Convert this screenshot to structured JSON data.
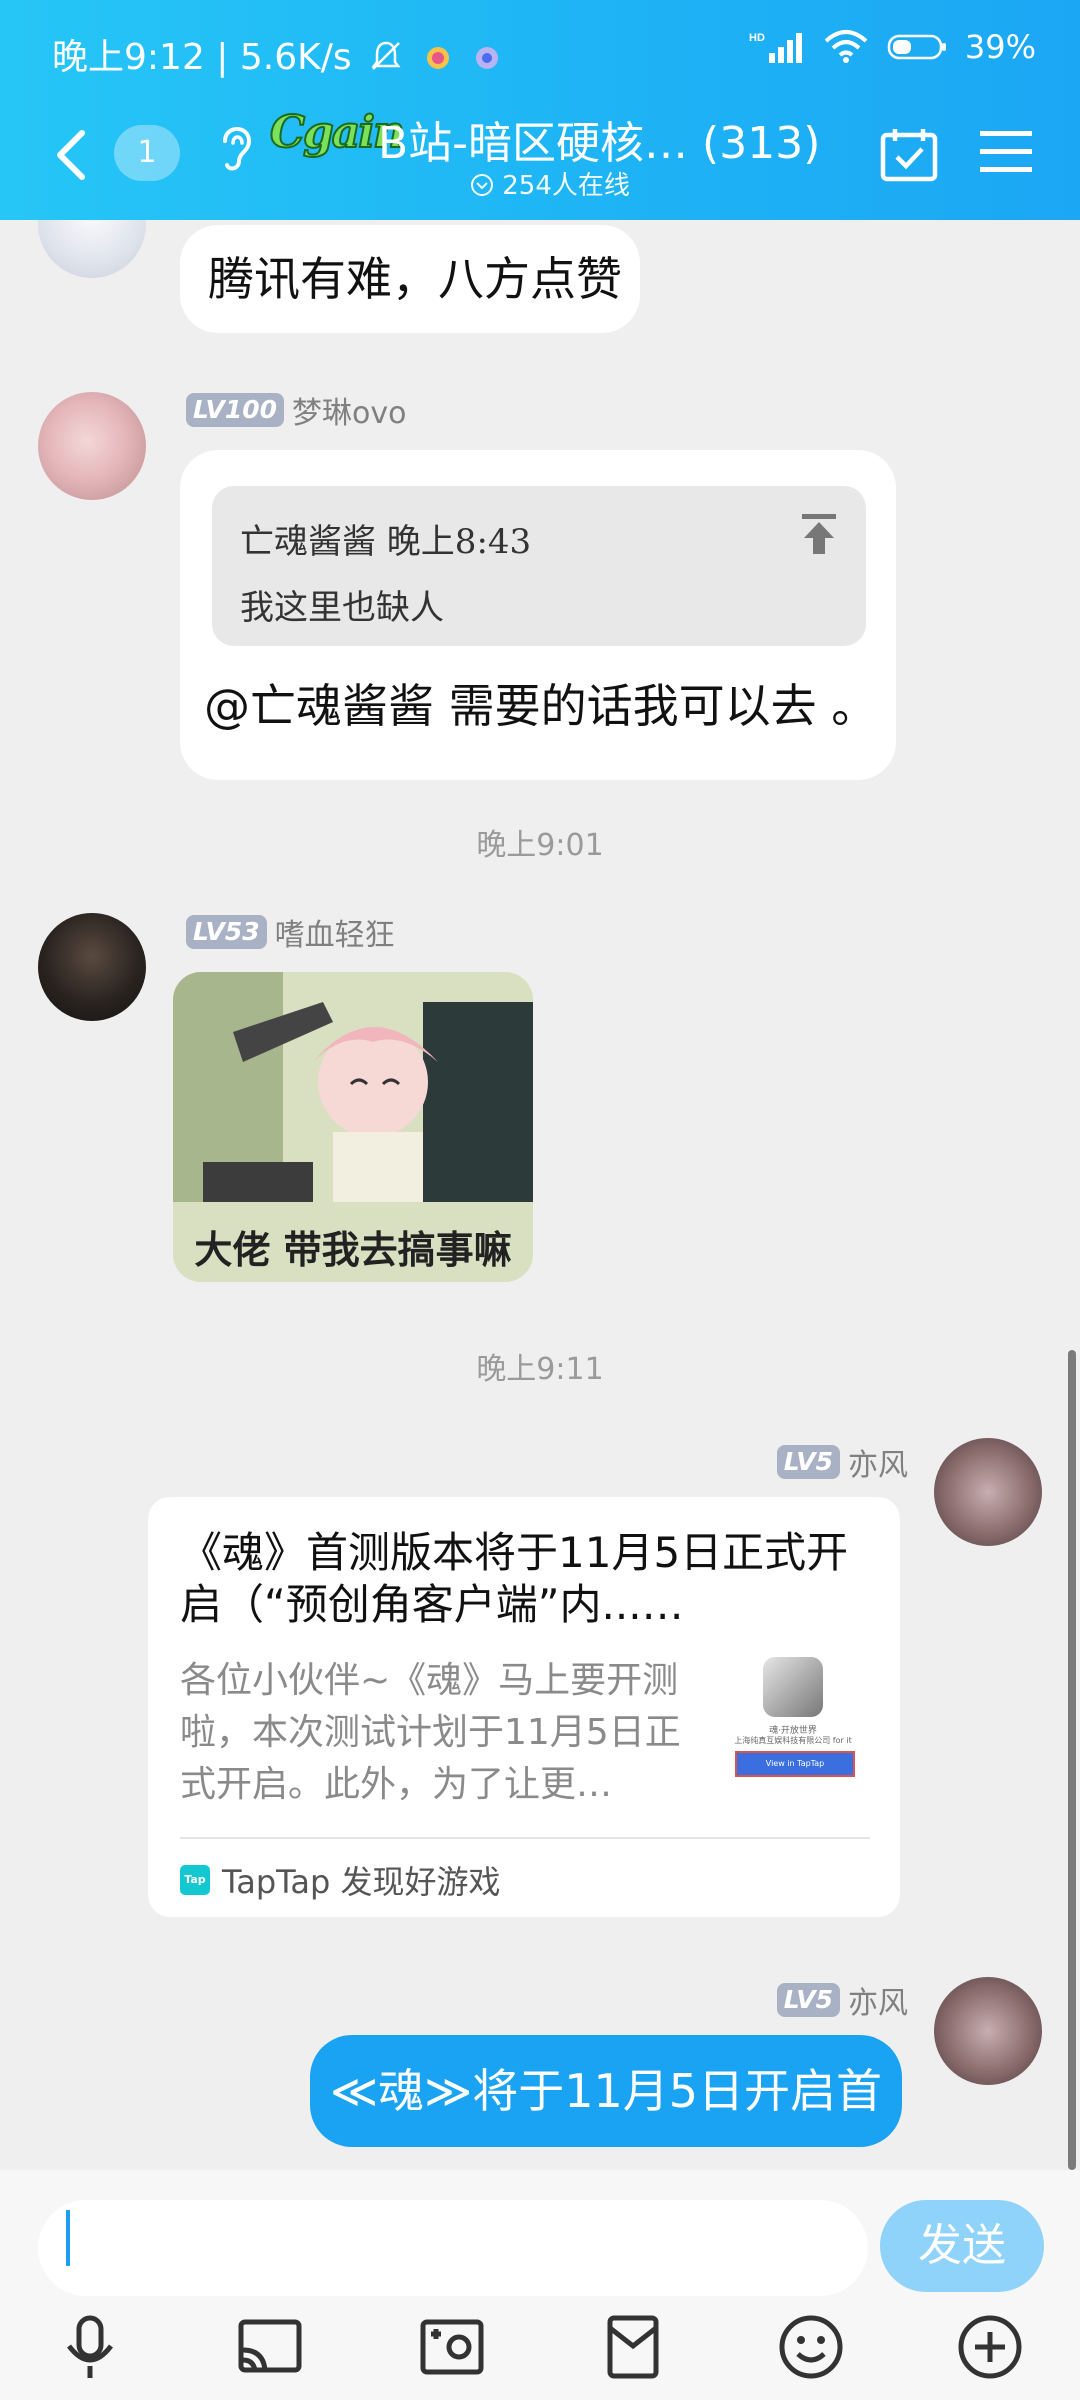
{
  "status_bar": {
    "time": "晚上9:12",
    "speed": "5.6K/s",
    "battery": "39%"
  },
  "header": {
    "unread_count": "1",
    "logo_text": "Cgain",
    "title": "B站-暗区硬核… (313)",
    "online": "254人在线"
  },
  "messages": {
    "m1": {
      "text": "腾讯有难，八方点赞"
    },
    "m2": {
      "level": "LV100",
      "name": "梦琳ovo",
      "quote_author_time": "亡魂酱酱  晚上8:43",
      "quote_text": "我这里也缺人",
      "text": "@亡魂酱酱  需要的话我可以去 。"
    },
    "t1": "晚上9:01",
    "m3": {
      "level": "LV53",
      "name": "嗜血轻狂",
      "sticker_caption": "大佬  带我去搞事嘛"
    },
    "t2": "晚上9:11",
    "m4": {
      "level": "LV5",
      "name": "亦风",
      "card_title": "《魂》首测版本将于11月5日正式开启（“预创角客户端”内...…",
      "card_desc": "各位小伙伴~《魂》马上要开测啦，本次测试计划于11月5日正式开启。此外，为了让更…",
      "thumb_line1": "魂·开放世界",
      "thumb_line2": "上海纯真互娱科技有限公司 for it",
      "thumb_button": "View in TapTap",
      "source_badge": "Tap",
      "source_name": "TapTap 发现好游戏"
    },
    "m5": {
      "level": "LV5",
      "name": "亦风",
      "text": "≪魂≫将于11月5日开启首测"
    }
  },
  "input": {
    "value": "",
    "send_label": "发送"
  },
  "toolbar": {
    "icons": [
      "microphone-icon",
      "screen-share-icon",
      "photo-icon",
      "hongbao-icon",
      "emoji-icon",
      "plus-icon"
    ]
  },
  "colors": {
    "header_blue": "#1eb4f5",
    "bubble_blue": "#1aa2f3",
    "send_disabled": "#8fd2fa"
  }
}
